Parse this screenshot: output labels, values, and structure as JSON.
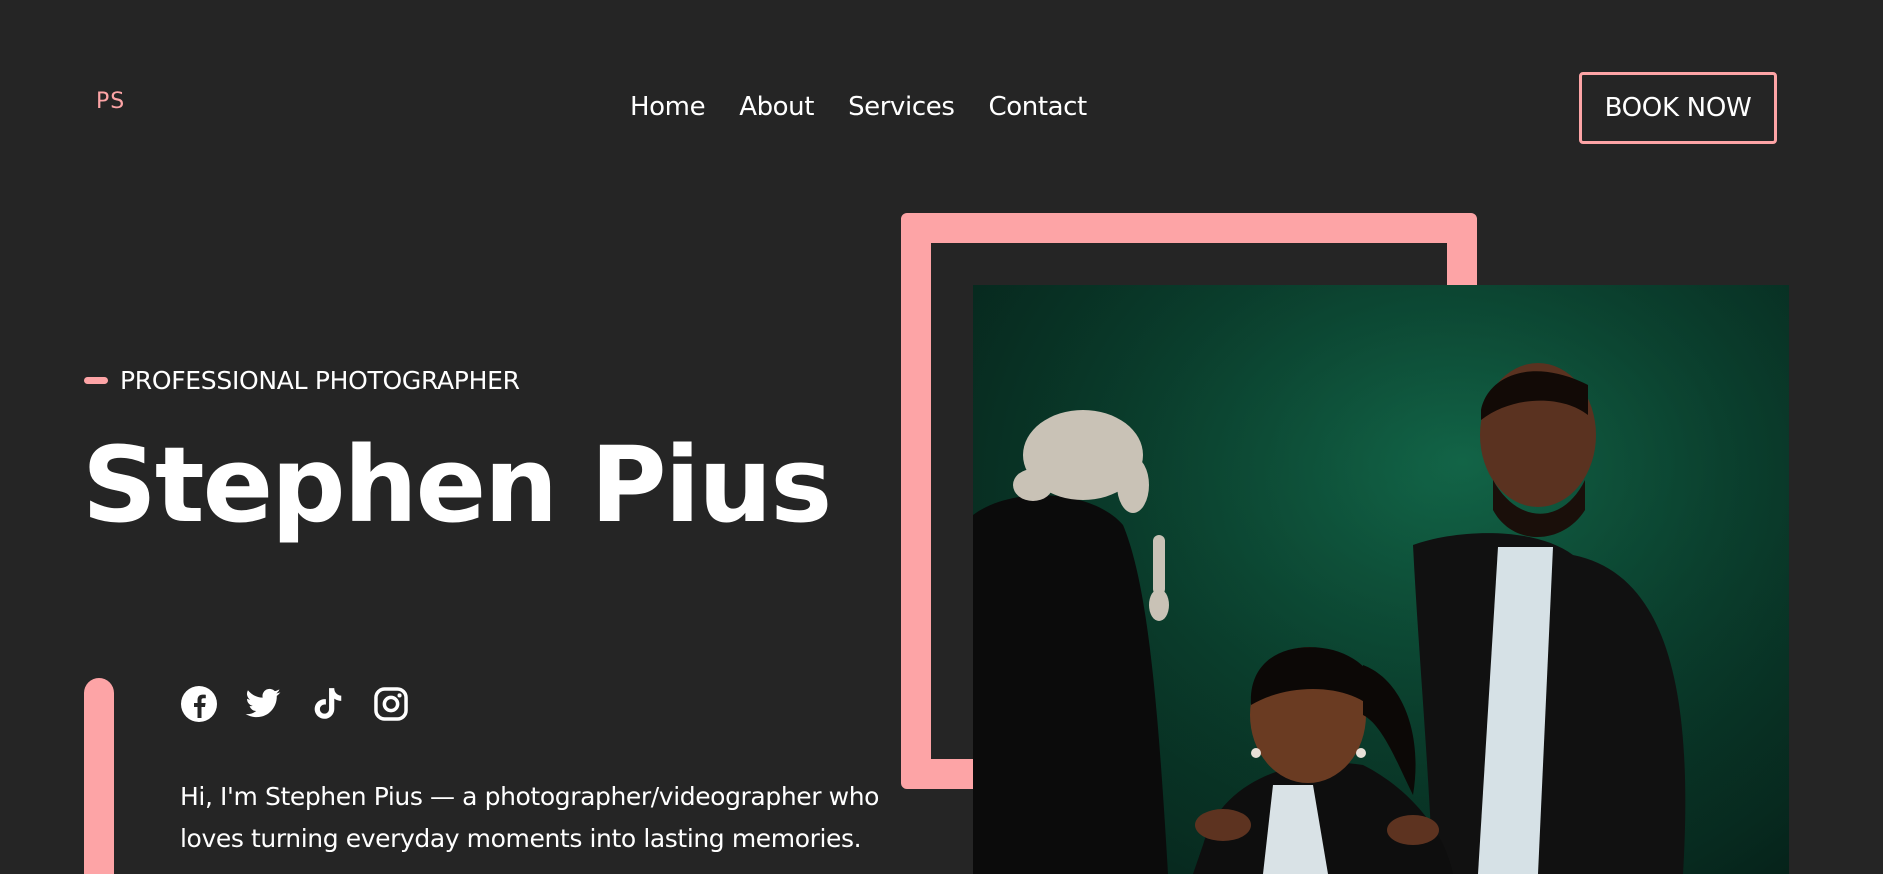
{
  "logo": {
    "text": "PS"
  },
  "nav": {
    "items": [
      {
        "label": "Home"
      },
      {
        "label": "About"
      },
      {
        "label": "Services"
      },
      {
        "label": "Contact"
      }
    ]
  },
  "header": {
    "cta_label": "BOOK NOW"
  },
  "hero": {
    "tagline": "PROFESSIONAL PHOTOGRAPHER",
    "name": "Stephen Pius",
    "bio_line1": "Hi, I'm Stephen Pius — a photographer/videographer who",
    "bio_line2": "loves turning everyday moments into lasting memories."
  },
  "socials": [
    {
      "icon": "facebook-icon"
    },
    {
      "icon": "twitter-icon"
    },
    {
      "icon": "tiktok-icon"
    },
    {
      "icon": "instagram-icon"
    }
  ],
  "colors": {
    "background": "#252525",
    "accent": "#fda4a6",
    "text": "#ffffff"
  }
}
